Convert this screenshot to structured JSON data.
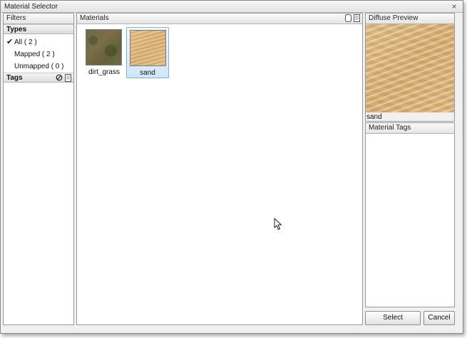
{
  "window": {
    "title": "Material Selector",
    "close_glyph": "×"
  },
  "filters": {
    "header": "Filters",
    "types_header": "Types",
    "types": [
      {
        "label": "All ( 2 )",
        "checked": true
      },
      {
        "label": "Mapped ( 2 )",
        "checked": false
      },
      {
        "label": "Unmapped ( 0 )",
        "checked": false
      }
    ],
    "tags_header": "Tags",
    "check_glyph": "✔"
  },
  "materials": {
    "header": "Materials",
    "items": [
      {
        "label": "dirt_grass",
        "texture": "dirt-grass",
        "selected": false
      },
      {
        "label": "sand",
        "texture": "sand",
        "selected": true
      }
    ]
  },
  "preview": {
    "header": "Diffuse Preview",
    "caption": "sand"
  },
  "material_tags": {
    "header": "Material Tags"
  },
  "buttons": {
    "select": "Select",
    "cancel": "Cancel"
  },
  "colors": {
    "selection_border": "#7fb2e0",
    "selection_fill": "#cfe6fb",
    "panel_border": "#9a9a9a"
  }
}
